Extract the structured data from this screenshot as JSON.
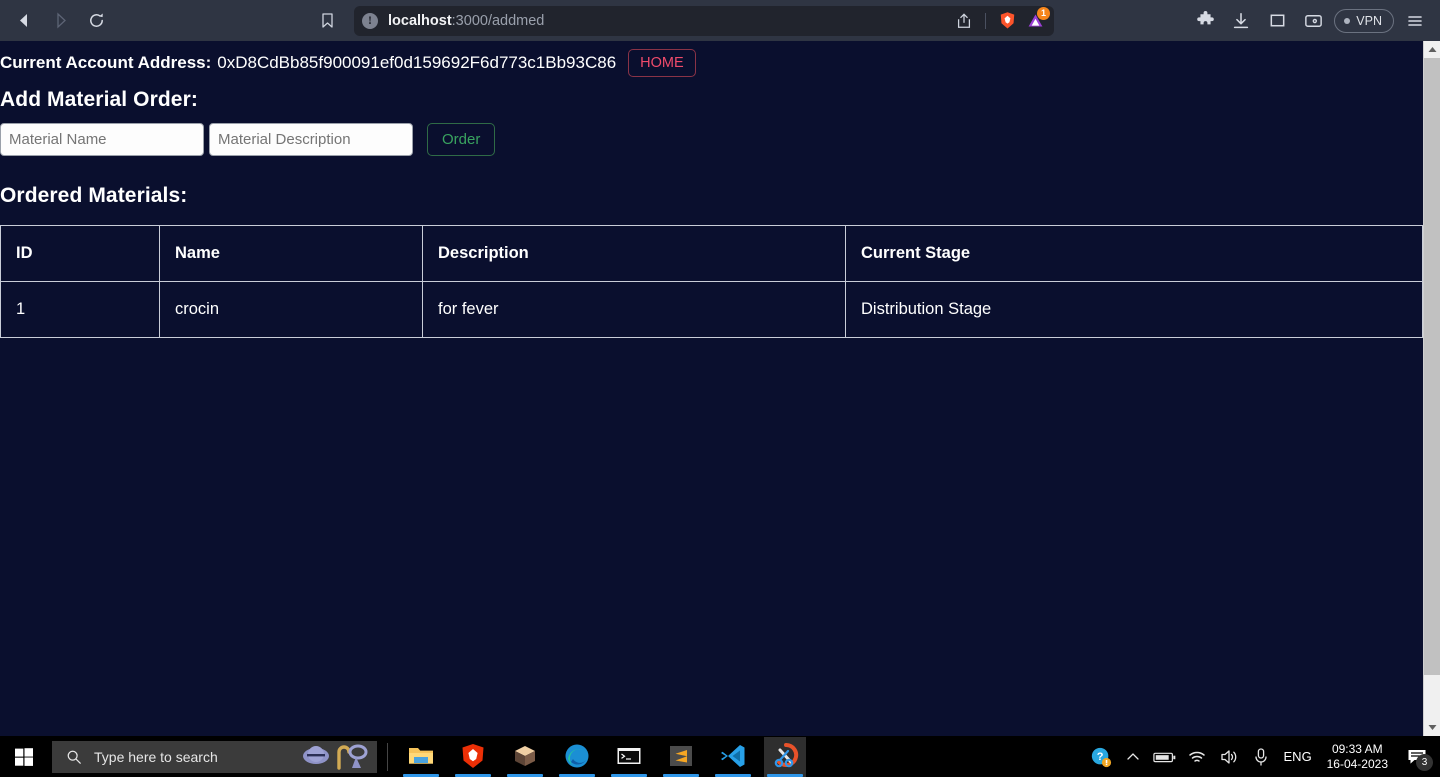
{
  "browser": {
    "nav": {
      "back_icon": "back-arrow-icon",
      "forward_icon": "forward-arrow-icon",
      "reload_icon": "reload-icon",
      "bookmark_icon": "bookmark-icon"
    },
    "omnibox": {
      "security_icon": "info-circle-icon",
      "url_host": "localhost",
      "url_path": ":3000/addmed",
      "share_icon": "share-icon",
      "brave_shield_icon": "brave-lion-icon",
      "metamask_icon": "metamask-fox-icon",
      "metamask_badge": "1"
    },
    "toolbar": {
      "extensions_icon": "puzzle-piece-icon",
      "downloads_icon": "download-icon",
      "sidebar_icon": "sidebar-panel-icon",
      "wallet_icon": "wallet-icon",
      "vpn_label": "VPN",
      "menu_icon": "hamburger-menu-icon"
    }
  },
  "page": {
    "account": {
      "label": "Current Account Address:",
      "address": "0xD8CdBb85f900091ef0d159692F6d773c1Bb93C86",
      "home_button": "HOME"
    },
    "add_order": {
      "title": "Add Material Order:",
      "name_placeholder": "Material Name",
      "name_value": "",
      "desc_placeholder": "Material Description",
      "desc_value": "",
      "order_button": "Order"
    },
    "materials": {
      "title": "Ordered Materials:",
      "columns": [
        "ID",
        "Name",
        "Description",
        "Current Stage"
      ],
      "rows": [
        {
          "id": "1",
          "name": "crocin",
          "description": "for fever",
          "stage": "Distribution Stage"
        }
      ]
    },
    "colors": {
      "background": "#0a0f2e",
      "home_accent": "#ef4b6b",
      "order_accent": "#39a35f",
      "table_border": "#c9cdd8"
    }
  },
  "scrollbar": {
    "up_icon": "scroll-up-arrow-icon",
    "down_icon": "scroll-down-arrow-icon"
  },
  "taskbar": {
    "start_icon": "windows-start-icon",
    "search": {
      "icon": "search-icon",
      "placeholder": "Type here to search",
      "value": ""
    },
    "apps": [
      {
        "name": "file-explorer",
        "label": "File Explorer",
        "active": false
      },
      {
        "name": "brave-browser",
        "label": "Brave",
        "active": false
      },
      {
        "name": "ganache",
        "label": "Ganache",
        "active": false
      },
      {
        "name": "microsoft-edge",
        "label": "Microsoft Edge",
        "active": false
      },
      {
        "name": "command-prompt",
        "label": "Command Prompt",
        "active": false
      },
      {
        "name": "sublime-text",
        "label": "Sublime Text",
        "active": false
      },
      {
        "name": "vs-code",
        "label": "Visual Studio Code",
        "active": false
      },
      {
        "name": "snipping-tool",
        "label": "Snipping Tool",
        "active": true
      }
    ],
    "tray": {
      "help_icon": "help-circle-icon",
      "overflow_icon": "chevron-up-icon",
      "battery_icon": "battery-icon",
      "network_icon": "wifi-icon",
      "volume_icon": "speaker-icon",
      "mic_icon": "microphone-icon",
      "language": "ENG",
      "time": "09:33 AM",
      "date": "16-04-2023",
      "notification_icon": "notification-icon",
      "notification_count": "3"
    }
  }
}
